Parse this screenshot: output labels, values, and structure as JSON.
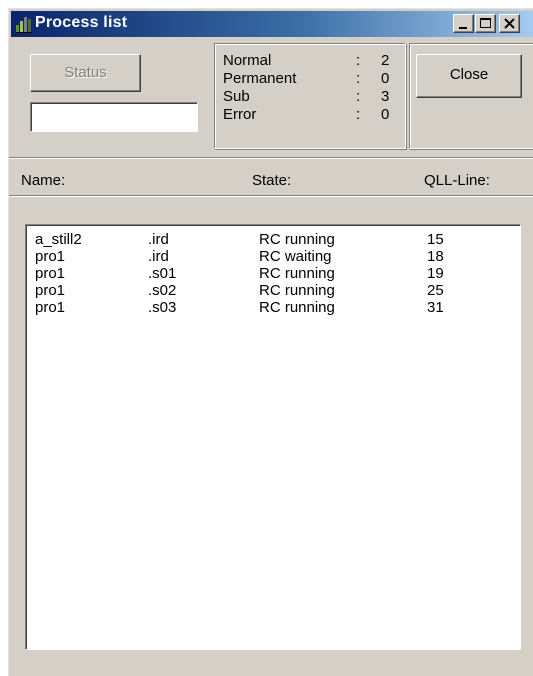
{
  "window": {
    "title": "Process list",
    "icon": "app-bars-icon",
    "controls": [
      "minimize-icon",
      "maximize-icon",
      "close-icon"
    ]
  },
  "toolbar": {
    "status_label": "Status",
    "status_field_value": "",
    "close_label": "Close"
  },
  "stats": [
    {
      "label": "Normal",
      "colon": ":",
      "value": "2"
    },
    {
      "label": "Permanent",
      "colon": ":",
      "value": "0"
    },
    {
      "label": "Sub",
      "colon": ":",
      "value": "3"
    },
    {
      "label": "Error",
      "colon": ":",
      "value": "0"
    }
  ],
  "list": {
    "headers": {
      "name": "Name:",
      "state": "State:",
      "qll_line": "QLL-Line:"
    },
    "rows": [
      {
        "name": "a_still2",
        "ext": ".ird",
        "state": "RC running",
        "line": "15"
      },
      {
        "name": "pro1",
        "ext": ".ird",
        "state": "RC waiting",
        "line": "18"
      },
      {
        "name": "pro1",
        "ext": ".s01",
        "state": "RC running",
        "line": "19"
      },
      {
        "name": "pro1",
        "ext": ".s02",
        "state": "RC running",
        "line": "25"
      },
      {
        "name": "pro1",
        "ext": ".s03",
        "state": "RC running",
        "line": "31"
      }
    ]
  },
  "colors": {
    "title_gradient_start": "#0a246a",
    "title_gradient_end": "#a6caf0",
    "face": "#d4d0c8"
  }
}
